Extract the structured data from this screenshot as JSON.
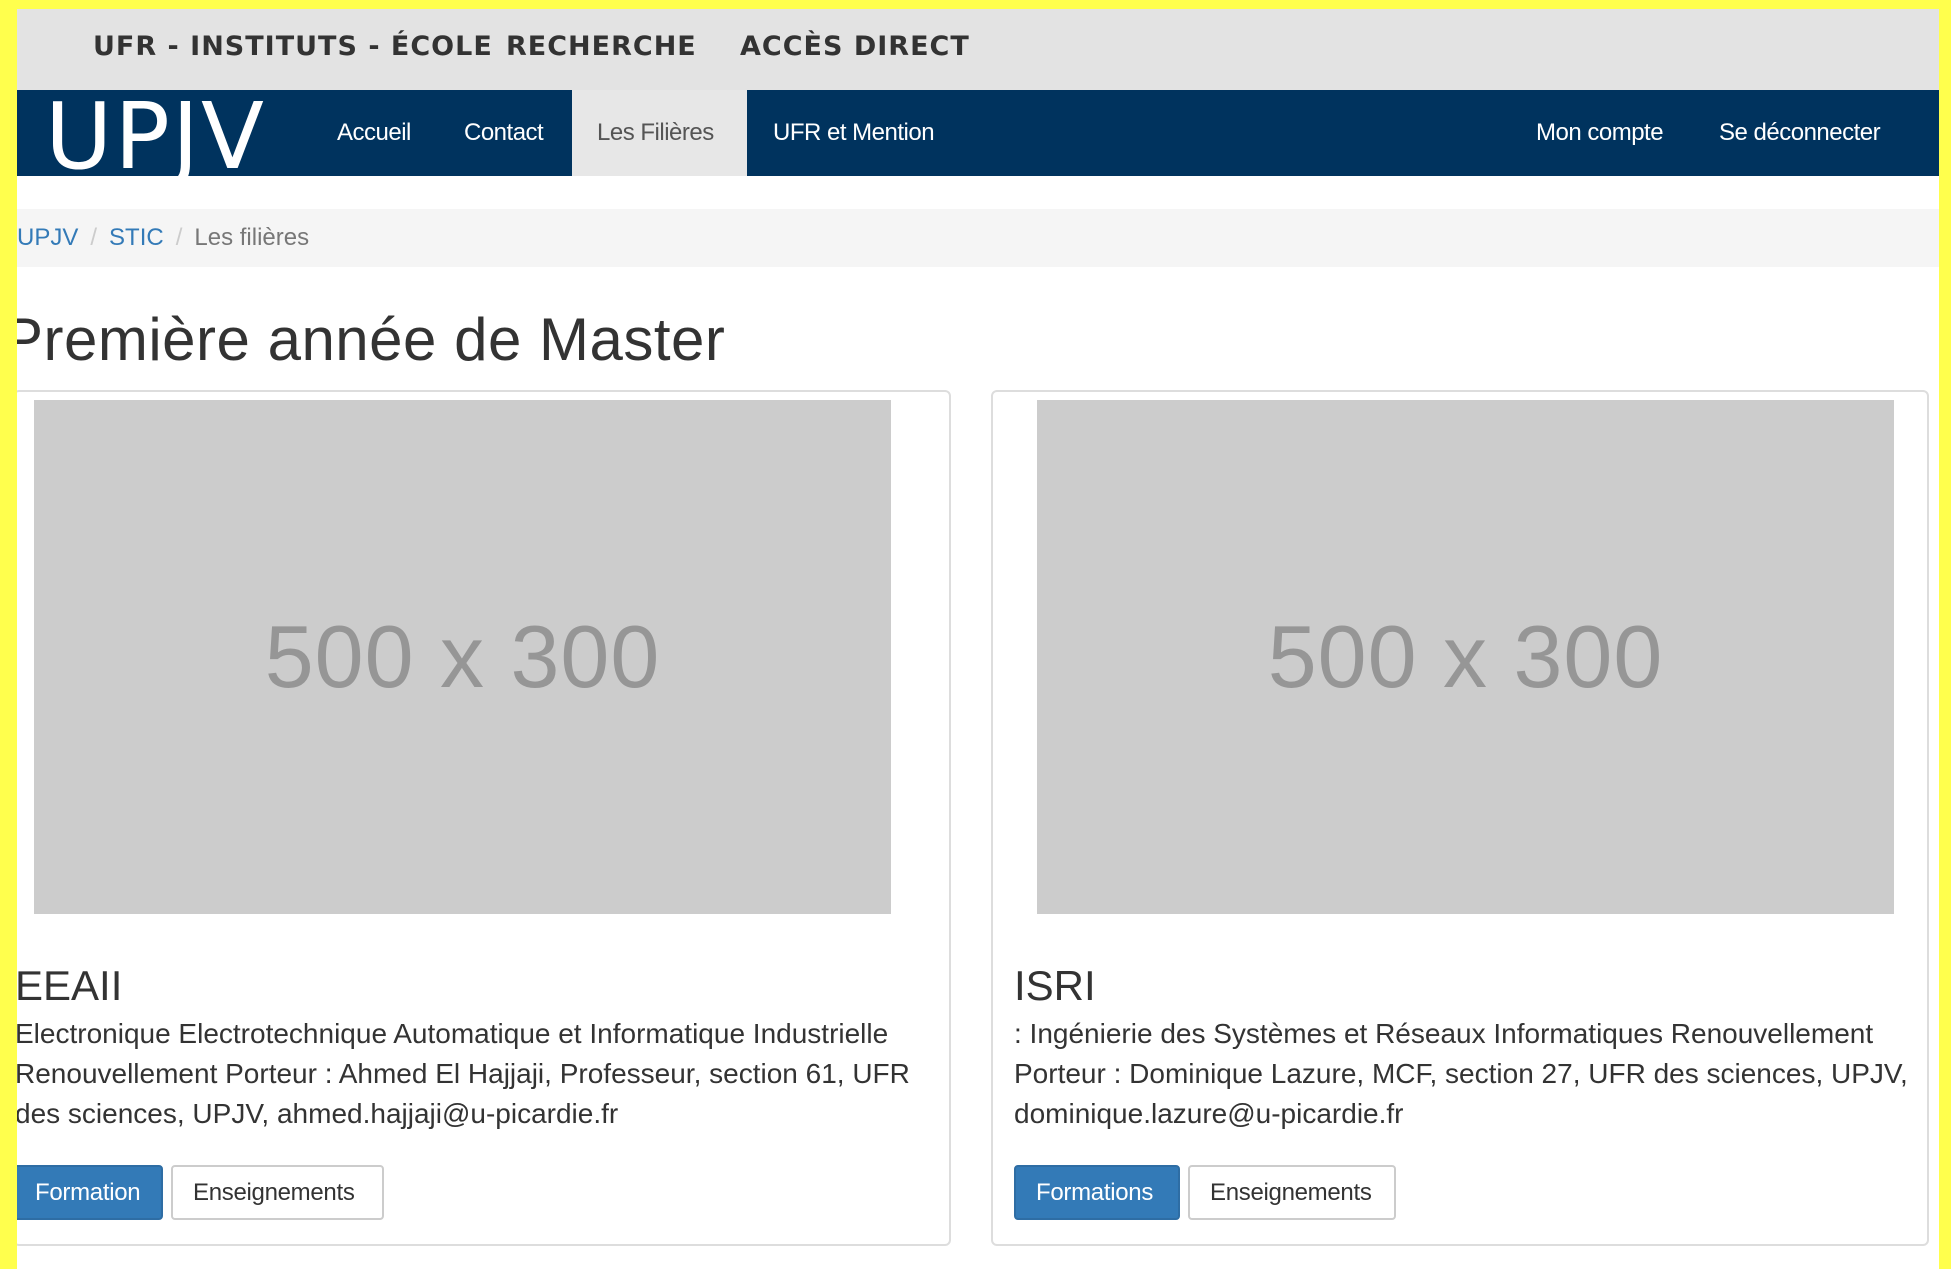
{
  "topbar": {
    "links": [
      "UFR - INSTITUTS - ÉCOLE",
      "RECHERCHE",
      "ACCÈS DIRECT"
    ]
  },
  "navbar": {
    "logo": "UPJV",
    "items": [
      "Accueil",
      "Contact",
      "Les Filières",
      "UFR et Mention"
    ],
    "active_item": "Les Filières",
    "right_items": [
      "Mon compte",
      "Se déconnecter"
    ],
    "bg_color": "#00335e"
  },
  "breadcrumb": {
    "items": [
      "UPJV",
      "STIC"
    ],
    "current": "Les filières"
  },
  "page": {
    "title": "Première année de Master"
  },
  "cards": [
    {
      "placeholder": "500 x 300",
      "title": "EEAII",
      "description": "Electronique Electrotechnique Automatique et Informatique Industrielle Renouvellement Porteur : Ahmed El Hajjaji, Professeur, section 61, UFR des sciences, UPJV, ahmed.hajjaji@u-picardie.fr",
      "primary_button": "Formation",
      "secondary_button": "Enseignements"
    },
    {
      "placeholder": "500 x 300",
      "title": "ISRI",
      "description": ": Ingénierie des Systèmes et Réseaux Informatiques Renouvellement Porteur : Dominique Lazure, MCF, section 27, UFR des sciences, UPJV, dominique.lazure@u-picardie.fr",
      "primary_button": "Formations",
      "secondary_button": "Enseignements"
    }
  ]
}
